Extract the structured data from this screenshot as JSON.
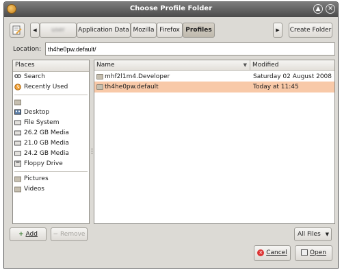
{
  "window": {
    "title": "Choose Profile Folder"
  },
  "titlebar_icons": {
    "app": "firefox-icon",
    "up": "▲",
    "close": "✕"
  },
  "pathbar": {
    "left_arrow": "◀",
    "right_arrow": "▶",
    "items": [
      "user",
      "Application Data",
      "Mozilla",
      "Firefox",
      "Profiles"
    ],
    "active_index": 4,
    "create_folder": "Create Folder"
  },
  "location": {
    "label": "Location:",
    "value": "th4he0pw.default/"
  },
  "places": {
    "header": "Places",
    "items": [
      {
        "label": "Search",
        "icon": "search-icon"
      },
      {
        "label": "Recently Used",
        "icon": "recent-icon"
      },
      {
        "label": "",
        "icon": "home-folder-icon"
      },
      {
        "label": "Desktop",
        "icon": "desktop-icon"
      },
      {
        "label": "File System",
        "icon": "drive-icon"
      },
      {
        "label": "26.2 GB Media",
        "icon": "drive-icon"
      },
      {
        "label": "21.0 GB Media",
        "icon": "drive-icon"
      },
      {
        "label": "24.2 GB Media",
        "icon": "drive-icon"
      },
      {
        "label": "Floppy Drive",
        "icon": "floppy-icon"
      }
    ],
    "bookmarks": [
      {
        "label": "Pictures",
        "icon": "folder-icon"
      },
      {
        "label": "Videos",
        "icon": "folder-icon"
      }
    ]
  },
  "files": {
    "columns": {
      "name": "Name",
      "modified": "Modified",
      "sort_arrow": "▼"
    },
    "rows": [
      {
        "name": "mhf2l1m4.Developer",
        "modified": "Saturday 02 August 2008",
        "selected": false
      },
      {
        "name": "th4he0pw.default",
        "modified": "Today at 11:45",
        "selected": true
      }
    ]
  },
  "buttons": {
    "add": "Add",
    "remove": "Remove",
    "filter": "All Files",
    "filter_arrow": "▼",
    "cancel": "Cancel",
    "open": "Open"
  },
  "colors": {
    "selection": "#f8c9a8",
    "title_bar": "#4a4a4a",
    "window_bg": "#dcdad5"
  }
}
